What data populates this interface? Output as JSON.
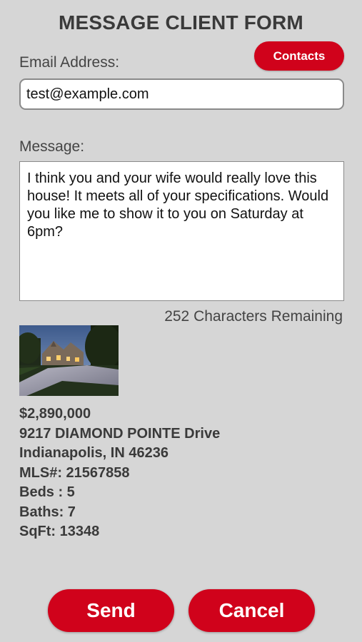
{
  "header": {
    "title": "MESSAGE CLIENT FORM"
  },
  "contacts_button": {
    "label": "Contacts"
  },
  "email": {
    "label": "Email Address:",
    "value": "test@example.com"
  },
  "message": {
    "label": "Message:",
    "value": "I think you and your wife would really love this house! It meets all of your specifications. Would you like me to show it to you on Saturday at 6pm?",
    "remaining": "252 Characters Remaining"
  },
  "listing": {
    "price": "$2,890,000",
    "address": "9217 DIAMOND POINTE Drive",
    "city": "Indianapolis, IN 46236",
    "mls": "MLS#: 21567858",
    "beds": "Beds : 5",
    "baths": "Baths: 7",
    "sqft": "SqFt: 13348"
  },
  "actions": {
    "send_label": "Send",
    "cancel_label": "Cancel"
  },
  "colors": {
    "accent": "#d0021b",
    "background": "#d6d6d6"
  }
}
